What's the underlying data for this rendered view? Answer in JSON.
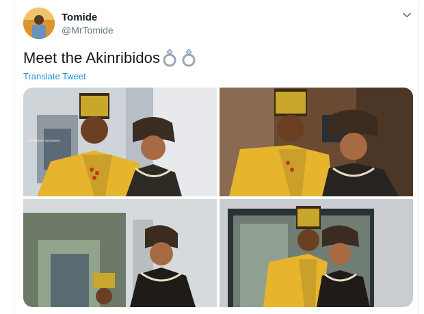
{
  "tweet": {
    "author_name": "Tomide",
    "author_handle": "@MrTomide",
    "text": "Meet the Akinribidos",
    "emoji": "ring-emoji",
    "translate_label": "Translate Tweet",
    "photo_watermark": "FOTOSHOOT WEDDINGS"
  },
  "icons": [
    "chevron-down-icon",
    "ring-emoji"
  ],
  "colors": {
    "name": "#14171a",
    "handle": "#657786",
    "link": "#1b95e0",
    "border": "#e6ecf0"
  },
  "media": {
    "photos": [
      {
        "label": "photo-1"
      },
      {
        "label": "photo-2"
      },
      {
        "label": "photo-3"
      },
      {
        "label": "photo-4"
      }
    ]
  }
}
